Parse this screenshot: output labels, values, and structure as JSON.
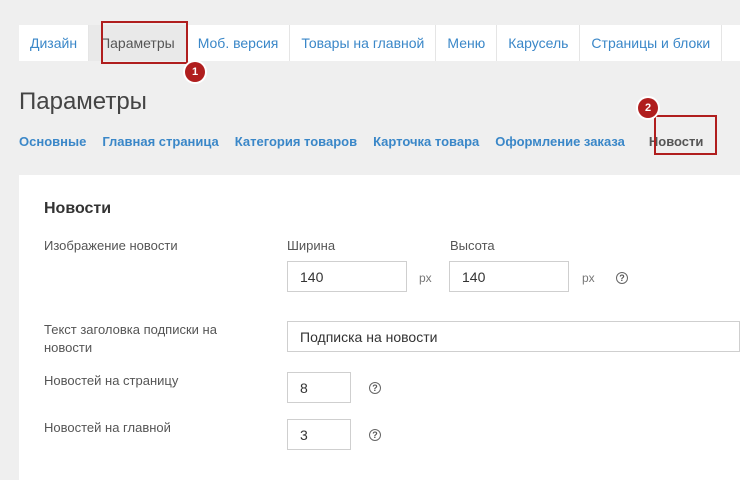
{
  "top_tabs": [
    {
      "label": "Дизайн"
    },
    {
      "label": "Параметры"
    },
    {
      "label": "Моб. версия"
    },
    {
      "label": "Товары на главной"
    },
    {
      "label": "Меню"
    },
    {
      "label": "Карусель"
    },
    {
      "label": "Страницы и блоки"
    }
  ],
  "badges": {
    "one": "1",
    "two": "2"
  },
  "page_title": "Параметры",
  "sub_tabs": [
    {
      "label": "Основные"
    },
    {
      "label": "Главная страница"
    },
    {
      "label": "Категория товаров"
    },
    {
      "label": "Карточка товара"
    },
    {
      "label": "Оформление заказа"
    },
    {
      "label": "Новости"
    }
  ],
  "news": {
    "title": "Новости",
    "image_label": "Изображение новости",
    "width_label": "Ширина",
    "width_value": "140",
    "height_label": "Высота",
    "height_value": "140",
    "unit": "px",
    "help_glyph": "?",
    "subscribe_label": "Текст заголовка подписки на новости",
    "subscribe_value": "Подписка на новости",
    "per_page_label": "Новостей на страницу",
    "per_page_value": "8",
    "on_main_label": "Новостей на главной",
    "on_main_value": "3"
  },
  "colors": {
    "link": "#3a87c8",
    "marker": "#b01e1e"
  }
}
